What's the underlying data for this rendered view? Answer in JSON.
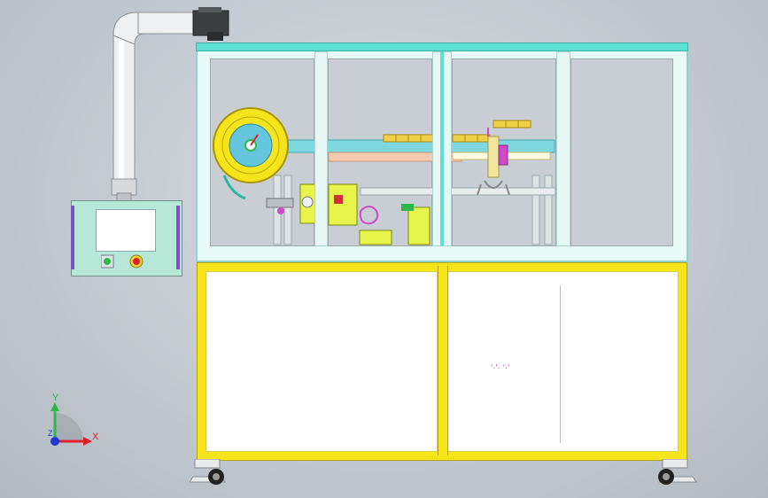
{
  "scene": {
    "type": "cad-assembly-front-view",
    "colors": {
      "background": "#c4cad1",
      "frame_upper": "#5fe0d4",
      "frame_lower": "#f6e51a",
      "panel": "#ffffff",
      "pendant": "#b6e7d7",
      "pendant_rail": "#7b4fd0",
      "reel": "#f6e51a",
      "reel_hub": "#66c6dd",
      "chain": "#f0cf4a",
      "magenta_part": "#d04ac8"
    }
  },
  "pendant": {
    "start_icon": "green-start-button-icon",
    "stop_icon": "red-emergency-stop-icon"
  },
  "panel_marking": "‘·'· ‘·'",
  "axis_triad": {
    "x_label": "X",
    "y_label": "Y",
    "z_label": "Z"
  }
}
